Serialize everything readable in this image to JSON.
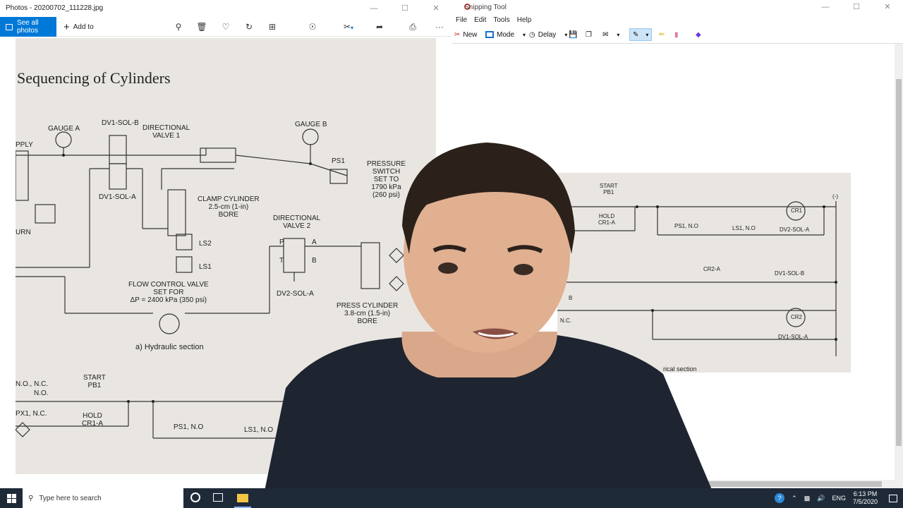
{
  "photos": {
    "title": "Photos - 20200702_111228.jpg",
    "see_all": "See all photos",
    "add_to": "Add to",
    "more": "···",
    "paper": {
      "title": "Sequencing of Cylinders",
      "labels": {
        "gauge_a": "GAUGE A",
        "dv1_sol_b": "DV1-SOL-B",
        "directional_valve_1": "DIRECTIONAL\nVALVE 1",
        "gauge_b": "GAUGE B",
        "ps1": "PS1",
        "pressure_switch": "PRESSURE\nSWITCH\nSET TO\n1790 kPa\n(260 psi)",
        "supply": "PPLY",
        "dv1_sol_a": "DV1-SOL-A",
        "clamp_cylinder": "CLAMP CYLINDER\n2.5-cm (1-in)\nBORE",
        "directional_valve_2": "DIRECTIONAL\nVALVE 2",
        "p": "P",
        "a": "A",
        "t": "T",
        "b": "B",
        "ls2": "LS2",
        "ls1": "LS1",
        "urn": "URN",
        "flow_control": "FLOW CONTROL VALVE\nSET FOR\nΔP = 2400 kPa (350 psi)",
        "dv2_sol_a": "DV2-SOL-A",
        "press_cylinder": "PRESS CYLINDER\n3.8-cm (1.5-in)\nBORE",
        "hydraulic_section": "a) Hydraulic section",
        "start_pb1": "START\nPB1",
        "no_nc": "N.O., N.C.",
        "no": "N.O.",
        "px1": "PX1, N.C.",
        "hold_cr1a": "HOLD\nCR1-A",
        "ps1_no": "PS1, N.O",
        "ls1_no": "LS1, N.O"
      }
    }
  },
  "snipping": {
    "title": "Snipping Tool",
    "menu": [
      "File",
      "Edit",
      "Tools",
      "Help"
    ],
    "new": "New",
    "mode": "Mode",
    "delay": "Delay",
    "snip_labels": {
      "start_pb1": "START\nPB1",
      "hold_cr1a": "HOLD\nCR1-A",
      "cr1": "CR1",
      "ps1_no": "PS1, N.O",
      "ls1_no": "LS1, N.O",
      "dv2_sol_a": "DV2-SOL-A",
      "cr2a": "CR2-A",
      "dv1_sol_b": "DV1-SOL-B",
      "cr2": "CR2",
      "dv1_sol_a": "DV1-SOL-A",
      "nc": "N.C.",
      "b": "B",
      "paren": "(-)",
      "rical_section": "rical section"
    }
  },
  "taskbar": {
    "search_placeholder": "Type here to search",
    "language": "ENG",
    "time": "6:13 PM",
    "date": "7/5/2020"
  }
}
